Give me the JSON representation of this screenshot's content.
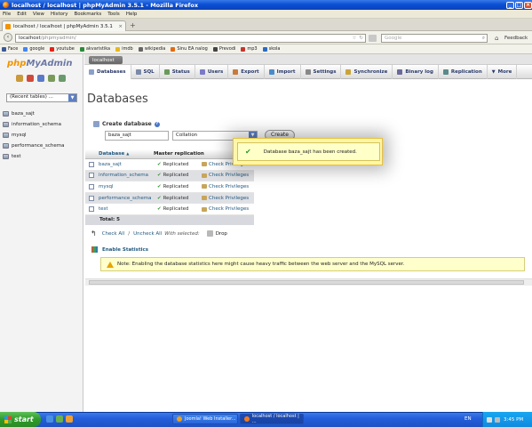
{
  "window": {
    "title": "localhost / localhost | phpMyAdmin 3.5.1 - Mozilla Firefox"
  },
  "menu": [
    "File",
    "Edit",
    "View",
    "History",
    "Bookmarks",
    "Tools",
    "Help"
  ],
  "tab": {
    "title": "localhost / localhost | phpMyAdmin 3.5.1"
  },
  "address": {
    "host": "localhost",
    "path": "/phpmyadmin/"
  },
  "search": {
    "placeholder": "Google"
  },
  "feedback": "Feedback",
  "bookmarks": [
    {
      "label": "Face",
      "color": "#3b5998"
    },
    {
      "label": "google",
      "color": "#4285f4"
    },
    {
      "label": "youtube",
      "color": "#e62117"
    },
    {
      "label": "akvaristika",
      "color": "#2a8a3a"
    },
    {
      "label": "imdb",
      "color": "#e6b91e"
    },
    {
      "label": "wikipedia",
      "color": "#666666"
    },
    {
      "label": "Sinu EA nalog",
      "color": "#e46a10"
    },
    {
      "label": "Prevodi",
      "color": "#444444"
    },
    {
      "label": "mp3",
      "color": "#c4362a"
    },
    {
      "label": "skola",
      "color": "#2a6ac4"
    }
  ],
  "pma": {
    "logo_a": "php",
    "logo_b": "MyAdmin",
    "server_tab": "localhost",
    "recent_tables": "(Recent tables) ...",
    "sidebar_dbs": [
      "baza_sajt",
      "information_schema",
      "mysql",
      "performance_schema",
      "test"
    ],
    "nav": [
      {
        "label": "Databases",
        "icon_color": "#8aa0c8",
        "active": true
      },
      {
        "label": "SQL",
        "icon_color": "#7a8aa8"
      },
      {
        "label": "Status",
        "icon_color": "#6a9a5a"
      },
      {
        "label": "Users",
        "icon_color": "#7a7ac8"
      },
      {
        "label": "Export",
        "icon_color": "#c87a3a"
      },
      {
        "label": "Import",
        "icon_color": "#4a8ac8"
      },
      {
        "label": "Settings",
        "icon_color": "#888888"
      },
      {
        "label": "Synchronize",
        "icon_color": "#c8a43a"
      },
      {
        "label": "Binary log",
        "icon_color": "#6a6a9a"
      },
      {
        "label": "Replication",
        "icon_color": "#5a8a8a"
      },
      {
        "label": "More",
        "icon_color": "#555555"
      }
    ],
    "heading": "Databases",
    "create_label": "Create database",
    "create_value": "baza_sajt",
    "collation_value": "Collation",
    "create_button": "Create",
    "table_headers": {
      "database": "Database",
      "sort_arrow": "▲",
      "replication": "Master replication"
    },
    "rows": [
      {
        "name": "baza_sajt",
        "replication": "Replicated",
        "action": "Check Privileges"
      },
      {
        "name": "information_schema",
        "replication": "Replicated",
        "action": "Check Privileges"
      },
      {
        "name": "mysql",
        "replication": "Replicated",
        "action": "Check Privileges"
      },
      {
        "name": "performance_schema",
        "replication": "Replicated",
        "action": "Check Privileges"
      },
      {
        "name": "test",
        "replication": "Replicated",
        "action": "Check Privileges"
      }
    ],
    "total": "Total: 5",
    "check_all": "Check All",
    "uncheck_all": "Uncheck All",
    "with_selected": "With selected:",
    "drop": "Drop",
    "enable_stats": "Enable Statistics",
    "note": "Note: Enabling the database statistics here might cause heavy traffic between the web server and the MySQL server.",
    "popup": "Database baza_sajt has been created."
  },
  "taskbar": {
    "start": "start",
    "windows": [
      {
        "label": "Joomla! Web Installer...",
        "icon_color": "#e8a020",
        "active": false
      },
      {
        "label": "localhost / localhost | ...",
        "icon_color": "#f07a20",
        "active": true
      }
    ],
    "lang": "EN",
    "time": "3:45 PM"
  }
}
